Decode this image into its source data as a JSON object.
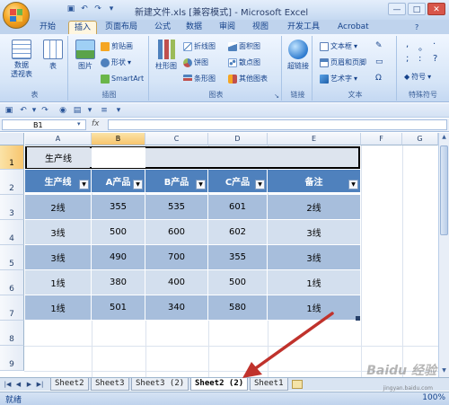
{
  "window": {
    "title": "新建文件.xls  [兼容模式] - Microsoft Excel",
    "controls": [
      "—",
      "□",
      "✕"
    ]
  },
  "ribbon_tabs": [
    "开始",
    "插入",
    "页面布局",
    "公式",
    "数据",
    "审阅",
    "视图",
    "开发工具",
    "Acrobat"
  ],
  "active_tab": "插入",
  "ribbon": {
    "groups": {
      "tables": {
        "label": "表",
        "pivot_label": "数据\n透视表",
        "table_label": "表"
      },
      "illustrations": {
        "label": "插图",
        "picture_label": "图片",
        "clipart_label": "剪贴画",
        "shapes_label": "形状",
        "smartart_label": "SmartArt"
      },
      "charts": {
        "label": "图表",
        "column_label": "柱形图",
        "line_label": "折线图",
        "pie_label": "饼图",
        "bar_label": "条形图",
        "area_label": "面积图",
        "scatter_label": "散点图",
        "other_label": "其他图表"
      },
      "links": {
        "label": "链接",
        "hyperlink_label": "超链接"
      },
      "text": {
        "label": "文本",
        "textbox_label": "文本框",
        "header_footer_label": "页眉和页脚",
        "wordart_label": "艺术字"
      },
      "special_chars": {
        "label": "特殊符号",
        "symbol_label": "符号"
      }
    }
  },
  "formula_bar": {
    "name_box": "B1",
    "fx": "fx",
    "value": ""
  },
  "columns": [
    "A",
    "B",
    "C",
    "D",
    "E",
    "F",
    "G"
  ],
  "rows": [
    "1",
    "2",
    "3",
    "4",
    "5",
    "6",
    "7",
    "8",
    "9"
  ],
  "sheet": {
    "a1": "生产线",
    "headers": [
      "生产线",
      "A产品",
      "B产品",
      "C产品",
      "备注"
    ],
    "data": [
      [
        "2线",
        "355",
        "535",
        "601",
        "2线"
      ],
      [
        "3线",
        "500",
        "600",
        "602",
        "3线"
      ],
      [
        "3线",
        "490",
        "700",
        "355",
        "3线"
      ],
      [
        "1线",
        "380",
        "400",
        "500",
        "1线"
      ],
      [
        "1线",
        "501",
        "340",
        "580",
        "1线"
      ]
    ]
  },
  "sheet_tabs": [
    "Sheet2",
    "Sheet3",
    "Sheet3 (2)",
    "Sheet2 (2)",
    "Sheet1"
  ],
  "active_sheet": "Sheet2 (2)",
  "status": {
    "ready": "就绪",
    "zoom": "100%"
  },
  "watermark": {
    "text": "Baidu 经验",
    "url": "jingyan.baidu.com"
  },
  "colors": {
    "header_fill": "#4f81bd",
    "band_dark": "#a7bedc",
    "band_light": "#d3dfee",
    "arrow": "#c0322c"
  }
}
